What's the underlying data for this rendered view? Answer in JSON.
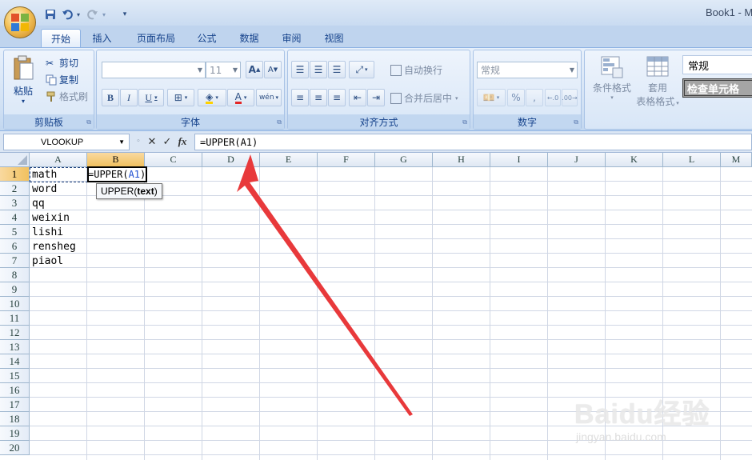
{
  "title_bar": {
    "book_title": "Book1 - M"
  },
  "ribbon_tabs": [
    "开始",
    "插入",
    "页面布局",
    "公式",
    "数据",
    "审阅",
    "视图"
  ],
  "clipboard": {
    "paste": "粘贴",
    "cut": "剪切",
    "copy": "复制",
    "format_painter": "格式刷",
    "group_label": "剪贴板"
  },
  "font": {
    "size": "11",
    "group_label": "字体"
  },
  "alignment": {
    "wrap_text": "自动换行",
    "merge_center": "合并后居中",
    "group_label": "对齐方式"
  },
  "number": {
    "format": "常规",
    "percent": "%",
    "comma": ",",
    "group_label": "数字"
  },
  "styles": {
    "conditional_format": "条件格式",
    "table_format_1": "套用",
    "table_format_2": "表格格式",
    "style_normal": "常规",
    "style_check_cell": "检查单元格"
  },
  "formula_bar": {
    "name_box": "VLOOKUP",
    "cancel": "✕",
    "enter": "✓",
    "fx": "fx",
    "formula": "=UPPER(A1)"
  },
  "columns": [
    "A",
    "B",
    "C",
    "D",
    "E",
    "F",
    "G",
    "H",
    "I",
    "J",
    "K",
    "L",
    "M"
  ],
  "rows": [
    "1",
    "2",
    "3",
    "4",
    "5",
    "6",
    "7",
    "8",
    "9",
    "10",
    "11",
    "12",
    "13",
    "14",
    "15",
    "16",
    "17",
    "18",
    "19",
    "20"
  ],
  "cells": {
    "A1": "math",
    "A2": "word",
    "A3": "qq",
    "A4": "weixin",
    "A5": "lishi",
    "A6": "rensheg",
    "A7": "piaol",
    "B1_prefix": "=UPPER(",
    "B1_ref": "A1",
    "B1_suffix": ")"
  },
  "tooltip": {
    "func": "UPPER(",
    "arg": "text",
    "close": ")"
  },
  "watermark": {
    "top": "Baidu经验",
    "bottom": "jingyan.baidu.com"
  },
  "colors": {
    "arrow": "#e8393b",
    "selection": "#f1c15f",
    "ribbon": "#d1e1f4"
  }
}
